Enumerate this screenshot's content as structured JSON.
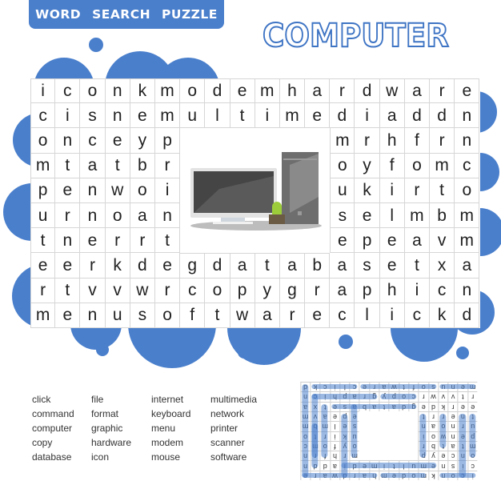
{
  "banner": {
    "label": "WORD SEARCH PUZZLE"
  },
  "title": "COMPUTER",
  "colors": {
    "accent": "#4a7fcc",
    "title_stroke": "#3e74c4",
    "grid_line": "#d6d6d6",
    "letter": "#222222"
  },
  "grid": {
    "rows": [
      [
        "i",
        "c",
        "o",
        "n",
        "k",
        "m",
        "o",
        "d",
        "e",
        "m",
        "h",
        "a",
        "r",
        "d",
        "w",
        "a",
        "r",
        "e"
      ],
      [
        "c",
        "i",
        "s",
        "n",
        "e",
        "m",
        "u",
        "l",
        "t",
        "i",
        "m",
        "e",
        "d",
        "i",
        "a",
        "d",
        "d",
        "n"
      ],
      [
        "o",
        "n",
        "c",
        "e",
        "y",
        "p",
        "",
        "",
        "",
        "",
        "",
        "",
        "m",
        "r",
        "h",
        "f",
        "r",
        "n"
      ],
      [
        "m",
        "t",
        "a",
        "t",
        "b",
        "r",
        "",
        "",
        "",
        "",
        "",
        "",
        "o",
        "y",
        "f",
        "o",
        "m",
        "c"
      ],
      [
        "p",
        "e",
        "n",
        "w",
        "o",
        "i",
        "",
        "",
        "",
        "",
        "",
        "",
        "u",
        "k",
        "i",
        "r",
        "t",
        "o"
      ],
      [
        "u",
        "r",
        "n",
        "o",
        "a",
        "n",
        "",
        "",
        "",
        "",
        "",
        "",
        "s",
        "e",
        "l",
        "m",
        "b",
        "m"
      ],
      [
        "t",
        "n",
        "e",
        "r",
        "r",
        "t",
        "",
        "",
        "",
        "",
        "",
        "",
        "e",
        "p",
        "e",
        "a",
        "v",
        "m"
      ],
      [
        "e",
        "e",
        "r",
        "k",
        "d",
        "e",
        "g",
        "d",
        "a",
        "t",
        "a",
        "b",
        "a",
        "s",
        "e",
        "t",
        "x",
        "a"
      ],
      [
        "r",
        "t",
        "v",
        "v",
        "w",
        "r",
        "c",
        "o",
        "p",
        "y",
        "g",
        "r",
        "a",
        "p",
        "h",
        "i",
        "c",
        "n"
      ],
      [
        "m",
        "e",
        "n",
        "u",
        "s",
        "o",
        "f",
        "t",
        "w",
        "a",
        "r",
        "e",
        "c",
        "l",
        "i",
        "c",
        "k",
        "d"
      ]
    ],
    "center_image": "desktop-computer-illustration"
  },
  "word_list": [
    [
      "click",
      "command",
      "computer",
      "copy",
      "database"
    ],
    [
      "file",
      "format",
      "graphic",
      "hardware",
      "icon"
    ],
    [
      "internet",
      "keyboard",
      "menu",
      "modem",
      "mouse"
    ],
    [
      "multimedia",
      "network",
      "printer",
      "scanner",
      "software"
    ]
  ],
  "solution": {
    "orientation": "upside-down",
    "found_words": [
      "icon",
      "modem",
      "hardware",
      "multimedia",
      "database",
      "copy",
      "graphic",
      "menu",
      "software",
      "click",
      "command",
      "computer",
      "printer",
      "internet",
      "network",
      "format",
      "keyboard",
      "file",
      "mouse",
      "scanner"
    ]
  }
}
